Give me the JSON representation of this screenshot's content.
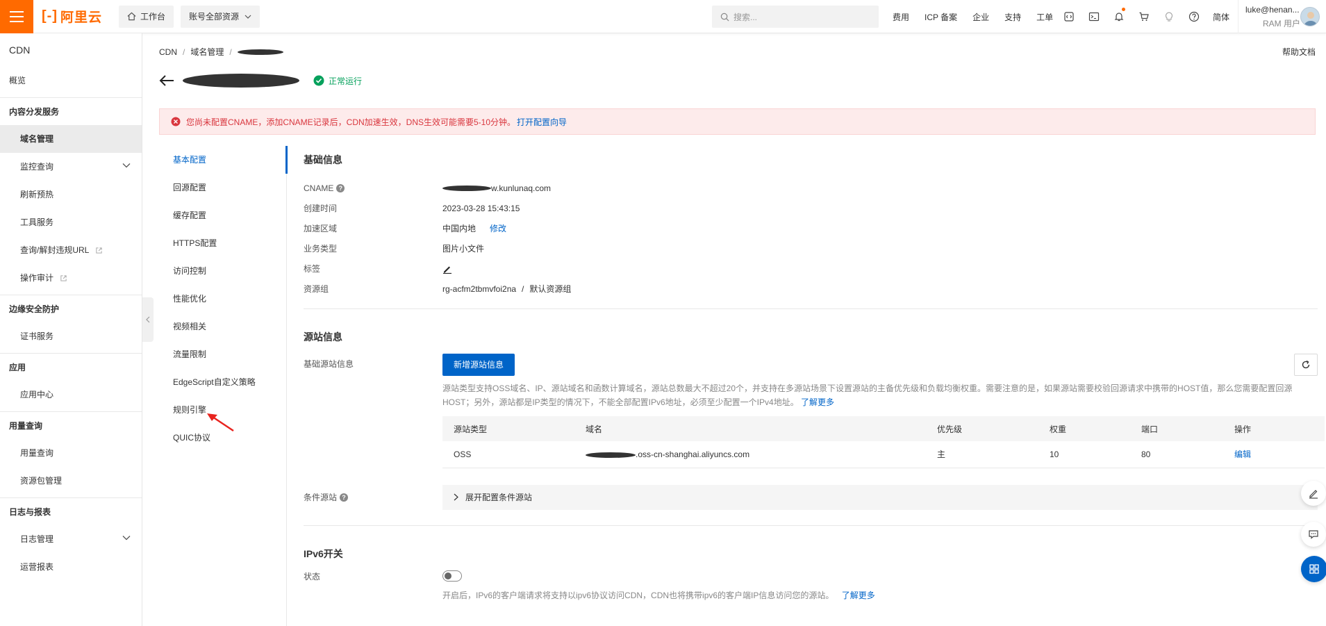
{
  "topbar": {
    "logo_text": "阿里云",
    "workbench_label": "工作台",
    "resource_scope_label": "账号全部资源",
    "search_placeholder": "搜索...",
    "nav_links": [
      "费用",
      "ICP 备案",
      "企业",
      "支持",
      "工单"
    ],
    "language": "简体",
    "user_name": "luke@henan...",
    "user_role": "RAM 用户"
  },
  "sidebar": {
    "title": "CDN",
    "overview": "概览",
    "groups": [
      {
        "label": "内容分发服务",
        "items": [
          "域名管理",
          "监控查询",
          "刷新预热",
          "工具服务",
          "查询/解封违规URL",
          "操作审计"
        ]
      },
      {
        "label": "边缘安全防护",
        "items": [
          "证书服务"
        ]
      },
      {
        "label": "应用",
        "items": [
          "应用中心"
        ]
      },
      {
        "label": "用量查询",
        "items": [
          "用量查询",
          "资源包管理"
        ]
      },
      {
        "label": "日志与报表",
        "items": [
          "日志管理",
          "运营报表"
        ]
      }
    ]
  },
  "breadcrumb": [
    "CDN",
    "域名管理"
  ],
  "help_link": "帮助文档",
  "status_text": "正常运行",
  "alert": {
    "text": "您尚未配置CNAME，添加CNAME记录后，CDN加速生效，DNS生效可能需要5-10分钟。",
    "link": "打开配置向导"
  },
  "subnav": [
    "基本配置",
    "回源配置",
    "缓存配置",
    "HTTPS配置",
    "访问控制",
    "性能优化",
    "视频相关",
    "流量限制",
    "EdgeScript自定义策略",
    "规则引擎",
    "QUIC协议"
  ],
  "basic_info": {
    "title": "基础信息",
    "cname_label": "CNAME",
    "cname_value": "w.kunlunaq.com",
    "created_label": "创建时间",
    "created_value": "2023-03-28 15:43:15",
    "region_label": "加速区域",
    "region_value": "中国内地",
    "region_edit": "修改",
    "biz_label": "业务类型",
    "biz_value": "图片小文件",
    "tag_label": "标签",
    "rg_label": "资源组",
    "rg_value": "rg-acfm2tbmvfoi2na",
    "rg_sep": "/",
    "rg_name": "默认资源组"
  },
  "origin_info": {
    "title": "源站信息",
    "base_label": "基础源站信息",
    "add_button": "新增源站信息",
    "desc": "源站类型支持OSS域名、IP、源站域名和函数计算域名，源站总数最大不超过20个，并支持在多源站场景下设置源站的主备优先级和负载均衡权重。需要注意的是，如果源站需要校验回源请求中携带的HOST值，那么您需要配置回源HOST；另外，源站都是IP类型的情况下，不能全部配置IPv6地址，必须至少配置一个IPv4地址。",
    "desc_link": "了解更多",
    "table_headers": [
      "源站类型",
      "域名",
      "优先级",
      "权重",
      "端口",
      "操作"
    ],
    "table_rows": [
      {
        "type": "OSS",
        "domain": ".oss-cn-shanghai.aliyuncs.com",
        "priority": "主",
        "weight": "10",
        "port": "80",
        "action": "编辑"
      }
    ],
    "cond_label": "条件源站",
    "cond_expand": "展开配置条件源站"
  },
  "ipv6": {
    "title": "IPv6开关",
    "status_label": "状态",
    "desc": "开启后，IPv6的客户端请求将支持以ipv6协议访问CDN，CDN也将携带ipv6的客户端IP信息访问您的源站。",
    "desc_link": "了解更多"
  },
  "colors": {
    "brand": "#ff6a00",
    "primary": "#0064c8",
    "success": "#06a15c",
    "error": "#d9363e"
  }
}
